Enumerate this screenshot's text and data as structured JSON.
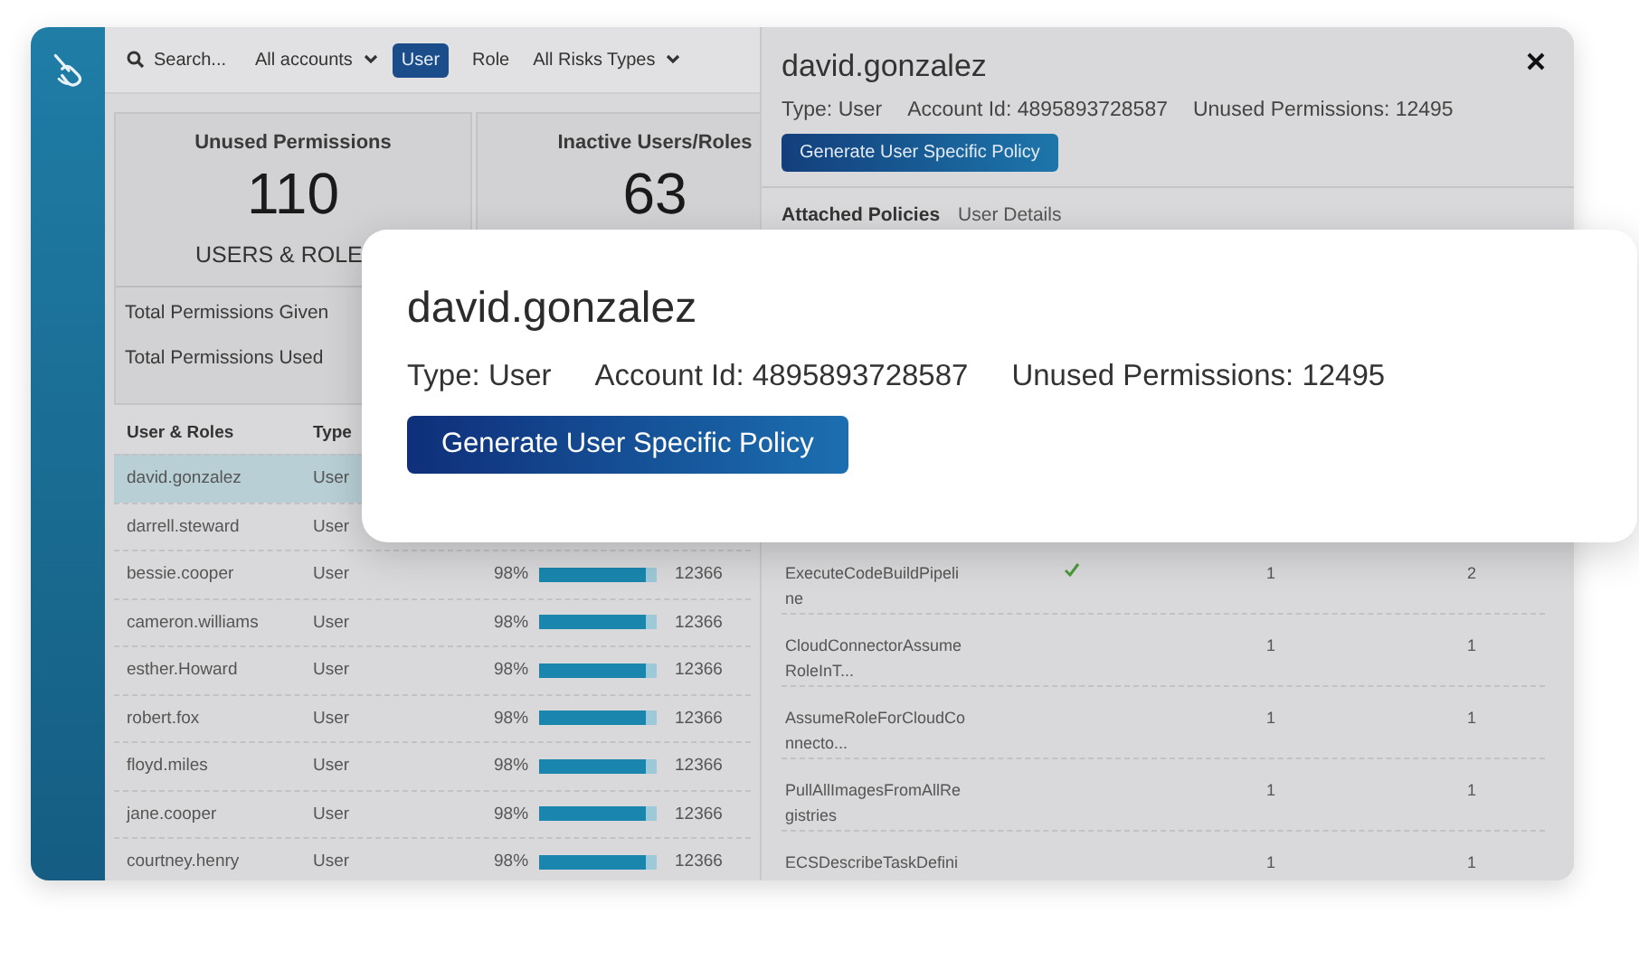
{
  "toolbar": {
    "search": {
      "placeholder": "Search..."
    },
    "account_filter": "All accounts",
    "type_filters": [
      {
        "label": "User",
        "selected": true
      },
      {
        "label": "Role",
        "selected": false
      }
    ],
    "risk_filter": "All Risks Types"
  },
  "summary_cards": [
    {
      "title": "Unused Permissions",
      "value": "110",
      "subtitle": "USERS & ROLE",
      "stats": [
        "Total Permissions Given",
        "Total Permissions Used"
      ]
    },
    {
      "title": "Inactive Users/Roles",
      "value": "63"
    }
  ],
  "users_table": {
    "columns": [
      "User & Roles",
      "Type"
    ],
    "rows": [
      {
        "name": "david.gonzalez",
        "type": "User",
        "selected": true
      },
      {
        "name": "darrell.steward",
        "type": "User",
        "selected": false
      },
      {
        "name": "bessie.cooper",
        "type": "User",
        "usage": "98%",
        "level": 0.9,
        "count": "12366",
        "selected": false
      },
      {
        "name": "cameron.williams",
        "type": "User",
        "usage": "98%",
        "level": 0.9,
        "count": "12366",
        "selected": false
      },
      {
        "name": "esther.Howard",
        "type": "User",
        "usage": "98%",
        "level": 0.9,
        "count": "12366",
        "selected": false
      },
      {
        "name": "robert.fox",
        "type": "User",
        "usage": "98%",
        "level": 0.9,
        "count": "12366",
        "selected": false
      },
      {
        "name": "floyd.miles",
        "type": "User",
        "usage": "98%",
        "level": 0.9,
        "count": "12366",
        "selected": false
      },
      {
        "name": "jane.cooper",
        "type": "User",
        "usage": "98%",
        "level": 0.9,
        "count": "12366",
        "selected": false
      },
      {
        "name": "courtney.henry",
        "type": "User",
        "usage": "98%",
        "level": 0.9,
        "count": "12366",
        "selected": false
      }
    ]
  },
  "details_panel": {
    "title": "david.gonzalez",
    "type": "Type: User",
    "account_id": "Account Id: 4895893728587",
    "unused": "Unused Permissions: 12495",
    "button": "Generate User Specific Policy",
    "tabs": [
      {
        "label": "Attached Policies",
        "selected": true
      },
      {
        "label": "User Details",
        "selected": false
      }
    ],
    "rows": [
      {
        "name": "ExecuteCodeBuildPipeline",
        "checked": true,
        "column_3": "1",
        "column_4": "2"
      },
      {
        "name": "CloudConnectorAssumeRoleInT...",
        "checked": false,
        "column_3": "1",
        "column_4": "1"
      },
      {
        "name": "AssumeRoleForCloudConnecto...",
        "checked": false,
        "column_3": "1",
        "column_4": "1"
      },
      {
        "name": "PullAllImagesFromAllRegistries",
        "checked": false,
        "column_3": "1",
        "column_4": "1"
      },
      {
        "name": "ECSDescribeTaskDefini",
        "checked": false,
        "column_3": "1",
        "column_4": "1"
      }
    ]
  },
  "callout": {
    "title": "david.gonzalez",
    "type": "Type: User",
    "account_id": "Account Id: 4895893728587",
    "unused": "Unused Permissions: 12495",
    "button": "Generate User Specific Policy"
  }
}
